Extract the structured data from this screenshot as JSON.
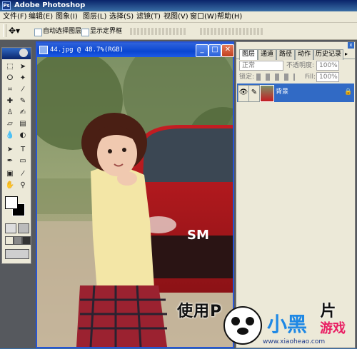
{
  "app": {
    "title": "Adobe Photoshop"
  },
  "menu": [
    "文件(F)",
    "编辑(E)",
    "图象(I)",
    "图层(L)",
    "选择(S)",
    "滤镜(T)",
    "视图(V)",
    "窗口(W)",
    "帮助(H)"
  ],
  "options_bar": {
    "auto_select_label": "自动选择图层",
    "show_bbox_label": "显示定界框"
  },
  "document": {
    "title": "44.jpg @ 48.7%(RGB)"
  },
  "layers_palette": {
    "tabs": [
      "图层",
      "通道",
      "路径",
      "动作",
      "历史记录"
    ],
    "blend_mode": "正常",
    "opacity_label": "不透明度:",
    "opacity_value": "100%",
    "lock_label": "锁定:",
    "fill_label": "Fill:",
    "fill_value": "100%",
    "layers": [
      {
        "name": "背景"
      }
    ]
  },
  "watermark": {
    "text": "使用P",
    "text_tail": "片",
    "site": "www.xiaoheao.com"
  },
  "colors": {
    "accent": "#316ac5",
    "titlebar": "#0a246a",
    "workspace": "#56595e"
  }
}
